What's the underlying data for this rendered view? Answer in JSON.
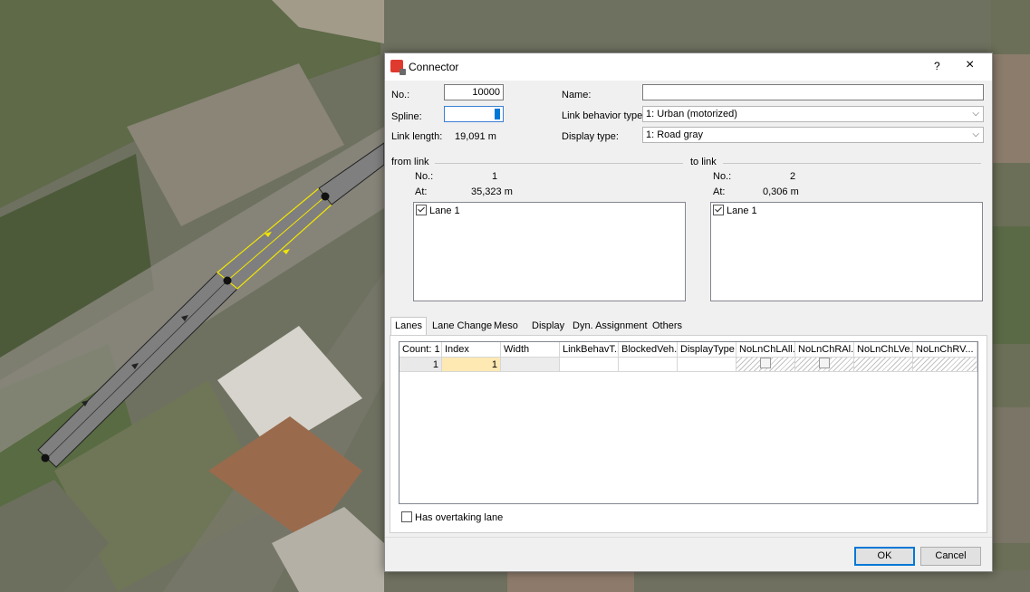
{
  "dialog": {
    "title": "Connector",
    "help_glyph": "?",
    "close_glyph": "×"
  },
  "fields": {
    "no_label": "No.:",
    "no_value": "10000",
    "spline_label": "Spline:",
    "link_length_label": "Link length:",
    "link_length_value": "19,091 m",
    "name_label": "Name:",
    "name_value": "",
    "link_behavior_label": "Link behavior type:",
    "link_behavior_value": "1: Urban (motorized)",
    "display_type_label": "Display type:",
    "display_type_value": "1: Road gray"
  },
  "from_link": {
    "title": "from link",
    "no_label": "No.:",
    "no_value": "1",
    "at_label": "At:",
    "at_value": "35,323 m",
    "lanes": [
      {
        "label": "Lane 1",
        "checked": true
      }
    ]
  },
  "to_link": {
    "title": "to link",
    "no_label": "No.:",
    "no_value": "2",
    "at_label": "At:",
    "at_value": "0,306 m",
    "lanes": [
      {
        "label": "Lane 1",
        "checked": true
      }
    ]
  },
  "tabs": [
    "Lanes",
    "Lane Change",
    "Meso",
    "Display",
    "Dyn. Assignment",
    "Others"
  ],
  "active_tab": "Lanes",
  "grid": {
    "headers": [
      "Count: 1",
      "Index",
      "Width",
      "LinkBehavT...",
      "BlockedVeh...",
      "DisplayType",
      "NoLnChLAll...",
      "NoLnChRAl...",
      "NoLnChLVe...",
      "NoLnChRV..."
    ],
    "row": {
      "count": "1",
      "index": "1",
      "width": "",
      "link_behav": "",
      "blocked_veh": "",
      "display_type": "",
      "no_ln_ch_l_all": false,
      "no_ln_ch_r_all": false
    }
  },
  "overtaking": {
    "label": "Has overtaking lane",
    "checked": false
  },
  "buttons": {
    "ok": "OK",
    "cancel": "Cancel"
  },
  "colors": {
    "link_fill": "#7f7f7f",
    "connector_outline": "#f2e600",
    "accent": "#0078d7",
    "index_cell": "#ffe9b3"
  }
}
